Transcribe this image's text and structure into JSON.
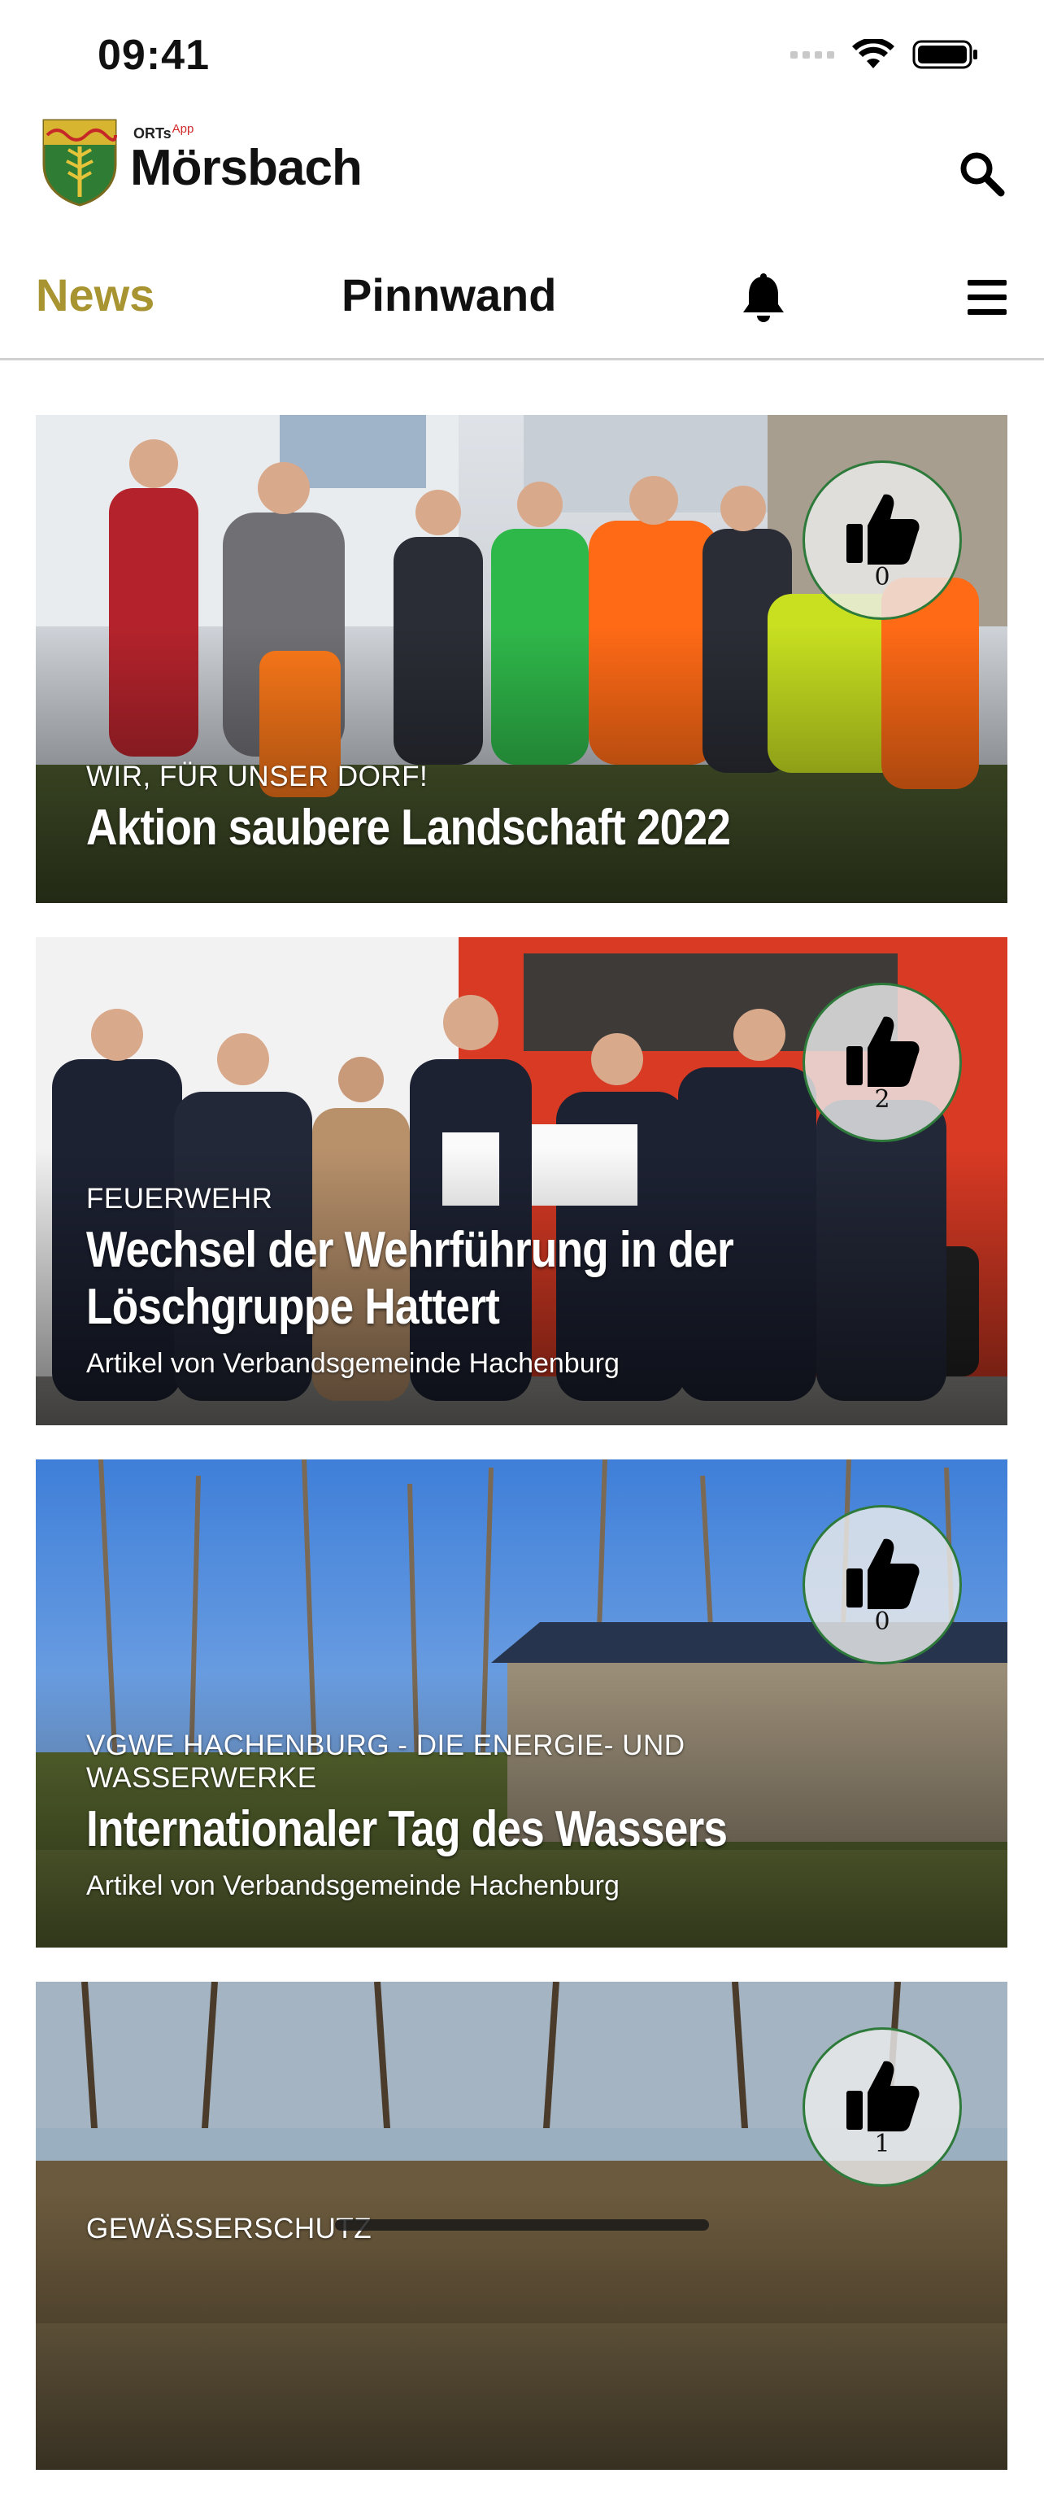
{
  "status_bar": {
    "time": "09:41"
  },
  "header": {
    "logo_small": "ORTs",
    "logo_app": "App",
    "logo_name": "Mörsbach"
  },
  "tabs": {
    "news": "News",
    "pinnwand": "Pinnwand"
  },
  "colors": {
    "accent": "#a99432",
    "like_border": "#2d7a3a"
  },
  "feed": [
    {
      "category": "WIR, FÜR UNSER DORF!",
      "title": "Aktion saubere Landschaft 2022",
      "author": "",
      "likes": "0"
    },
    {
      "category": "FEUERWEHR",
      "title": "Wechsel der Wehrführung in der Löschgruppe Hattert",
      "author": "Artikel von Verbandsgemeinde Hachenburg",
      "likes": "2"
    },
    {
      "category": "VGWE HACHENBURG - DIE ENERGIE- UND WASSERWERKE",
      "title": "Internationaler Tag des Wassers",
      "author": "Artikel von Verbandsgemeinde Hachenburg",
      "likes": "0"
    },
    {
      "category": "GEWÄSSERSCHUTZ",
      "title": "",
      "author": "",
      "likes": "1"
    }
  ]
}
